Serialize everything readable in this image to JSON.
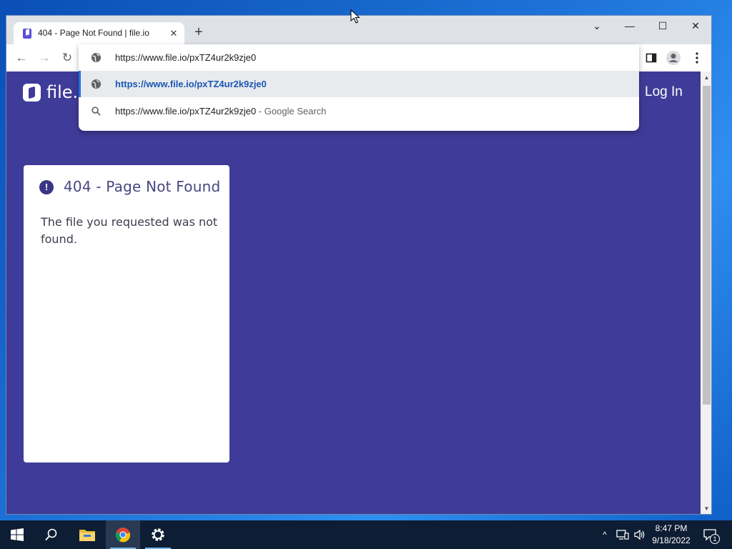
{
  "browser": {
    "tab": {
      "title": "404 - Page Not Found | file.io",
      "close": "✕"
    },
    "new_tab": "+",
    "window_controls": {
      "tab_search": "⌄",
      "minimize": "—",
      "maximize": "☐",
      "close": "✕"
    },
    "nav": {
      "back": "←",
      "forward": "→",
      "reload": "↻"
    },
    "omnibox": {
      "input_value": "https://www.file.io/pxTZ4ur2k9zje0",
      "suggestion": "https://www.file.io/pxTZ4ur2k9zje0",
      "search_query": "https://www.file.io/pxTZ4ur2k9zje0",
      "search_suffix": " - Google Search"
    },
    "icons": [
      "globe-icon",
      "search-icon",
      "side-panel-icon",
      "profile-icon",
      "more-menu-icon"
    ]
  },
  "page": {
    "logo_text": "file.io",
    "login_label": "Log In",
    "card": {
      "icon": "!",
      "title": "404 - Page Not Found",
      "message": "The file you requested was not found."
    },
    "colors": {
      "background": "#3f3b98",
      "card": "#ffffff",
      "accent": "#3a3685"
    }
  },
  "taskbar": {
    "items": [
      "start-icon",
      "search-icon",
      "file-explorer-icon",
      "chrome-icon",
      "settings-icon"
    ],
    "clock": {
      "time": "8:47 PM",
      "date": "9/18/2022"
    },
    "notification_count": "1"
  }
}
